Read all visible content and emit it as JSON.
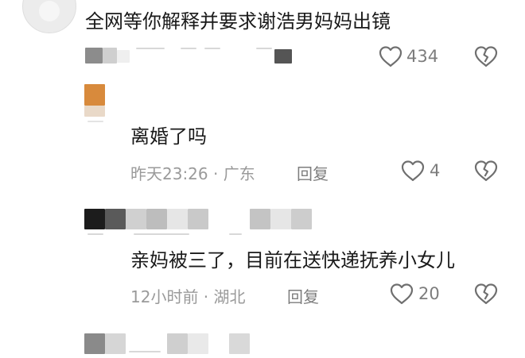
{
  "comments": [
    {
      "text": "全网等你解释并要求谢浩男妈妈出镜",
      "meta": "",
      "reply": "",
      "likes": "434"
    },
    {
      "text": "离婚了吗",
      "meta": "昨天23:26 · 广东",
      "reply": "回复",
      "likes": "4"
    },
    {
      "text": "亲妈被三了，目前在送快递抚养小女儿",
      "meta": "12小时前 · 湖北",
      "reply": "回复",
      "likes": "20"
    }
  ],
  "icons": {
    "like": "heart-outline-icon",
    "dislike": "broken-heart-icon"
  },
  "colors": {
    "meta_gray": "#9a9a9a",
    "icon_gray": "#7d7d7d",
    "avatar_orange": "#d88a3c"
  }
}
